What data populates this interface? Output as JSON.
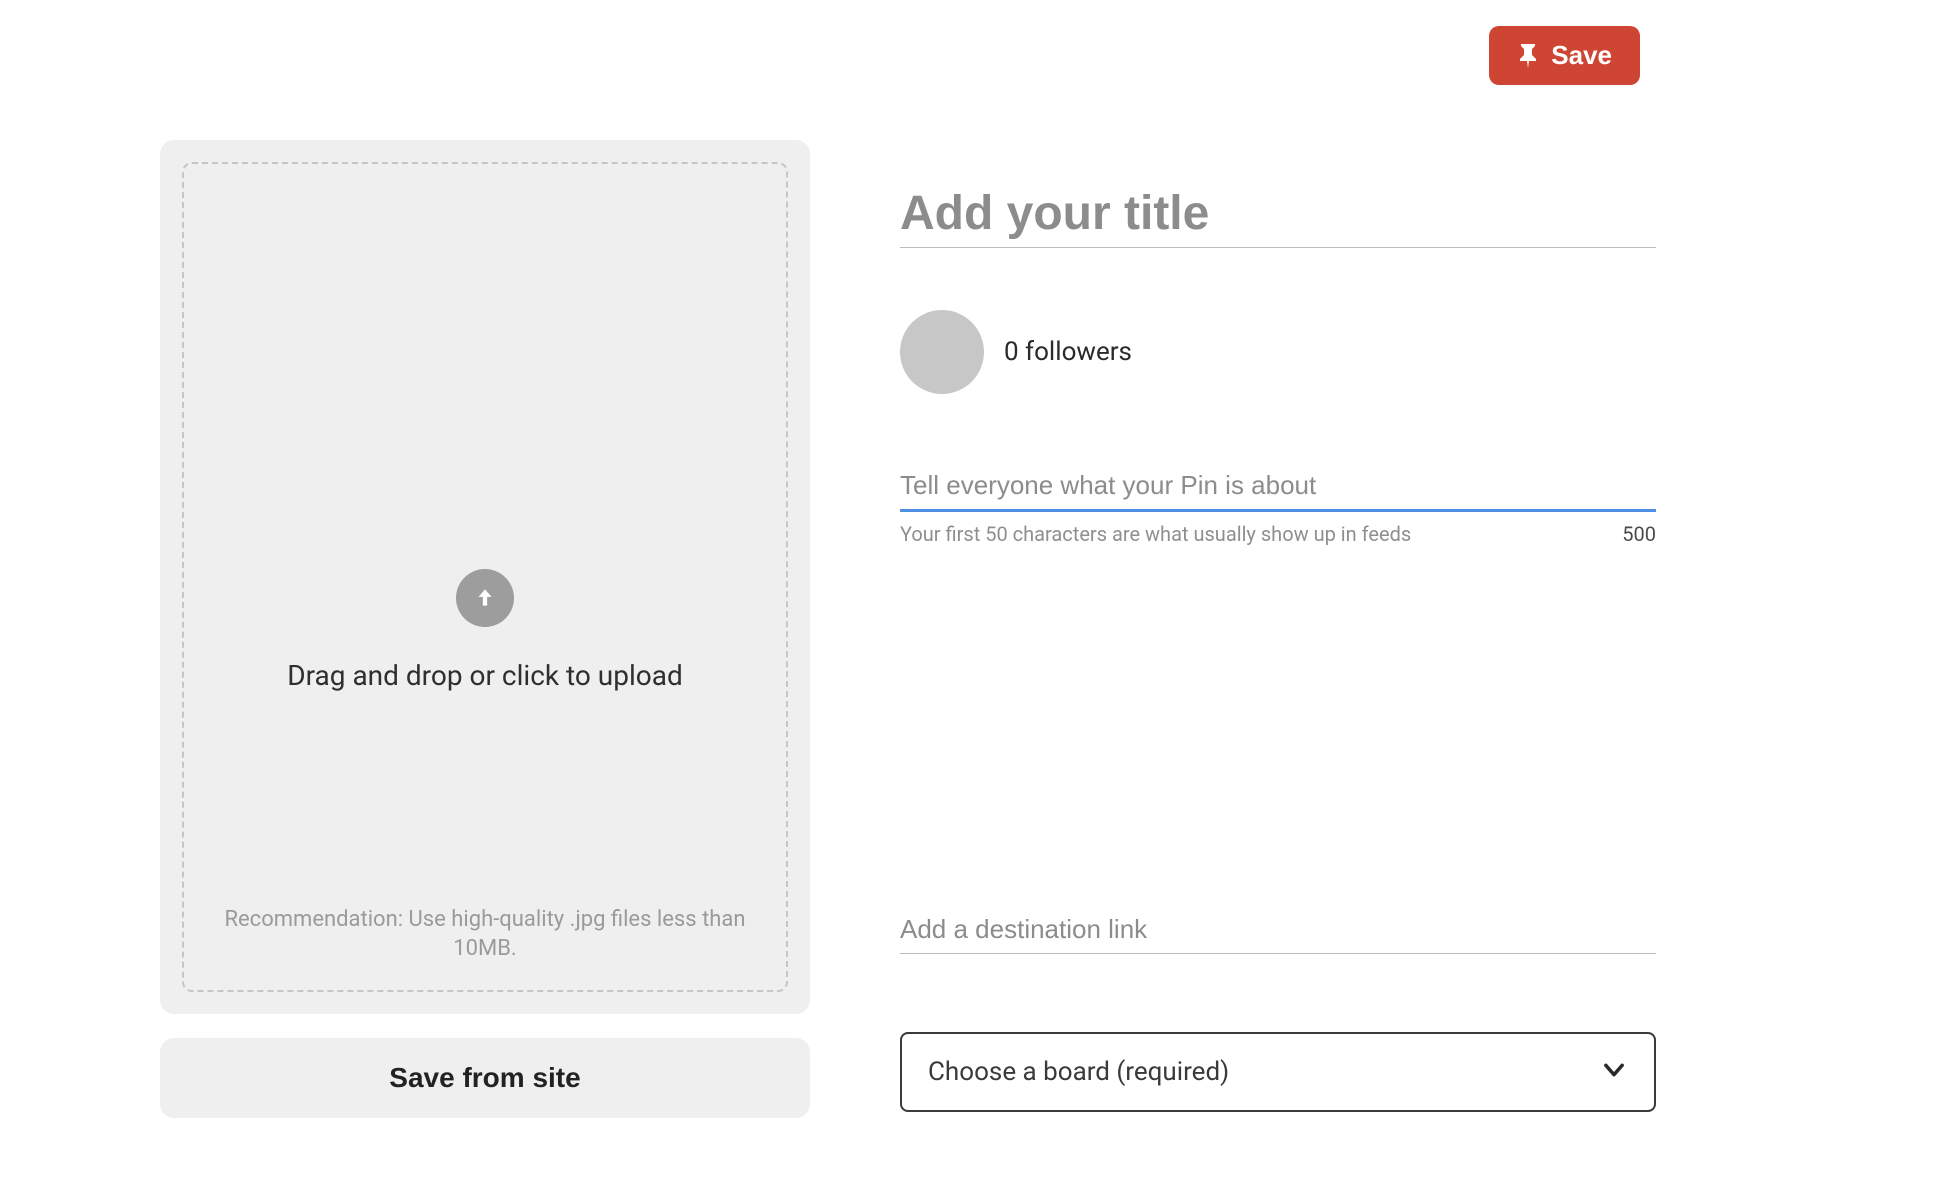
{
  "save_button": {
    "label": "Save"
  },
  "upload": {
    "label": "Drag and drop or click to upload",
    "hint": "Recommendation: Use high-quality .jpg files less than 10MB."
  },
  "save_from_site_label": "Save from site",
  "title": {
    "placeholder": "Add your title",
    "value": ""
  },
  "user": {
    "followers_text": "0 followers"
  },
  "description": {
    "placeholder": "Tell everyone what your Pin is about",
    "value": "",
    "hint": "Your first 50 characters are what usually show up in feeds",
    "char_limit": "500"
  },
  "destination_link": {
    "placeholder": "Add a destination link",
    "value": ""
  },
  "board_select": {
    "label": "Choose a board (required)"
  }
}
